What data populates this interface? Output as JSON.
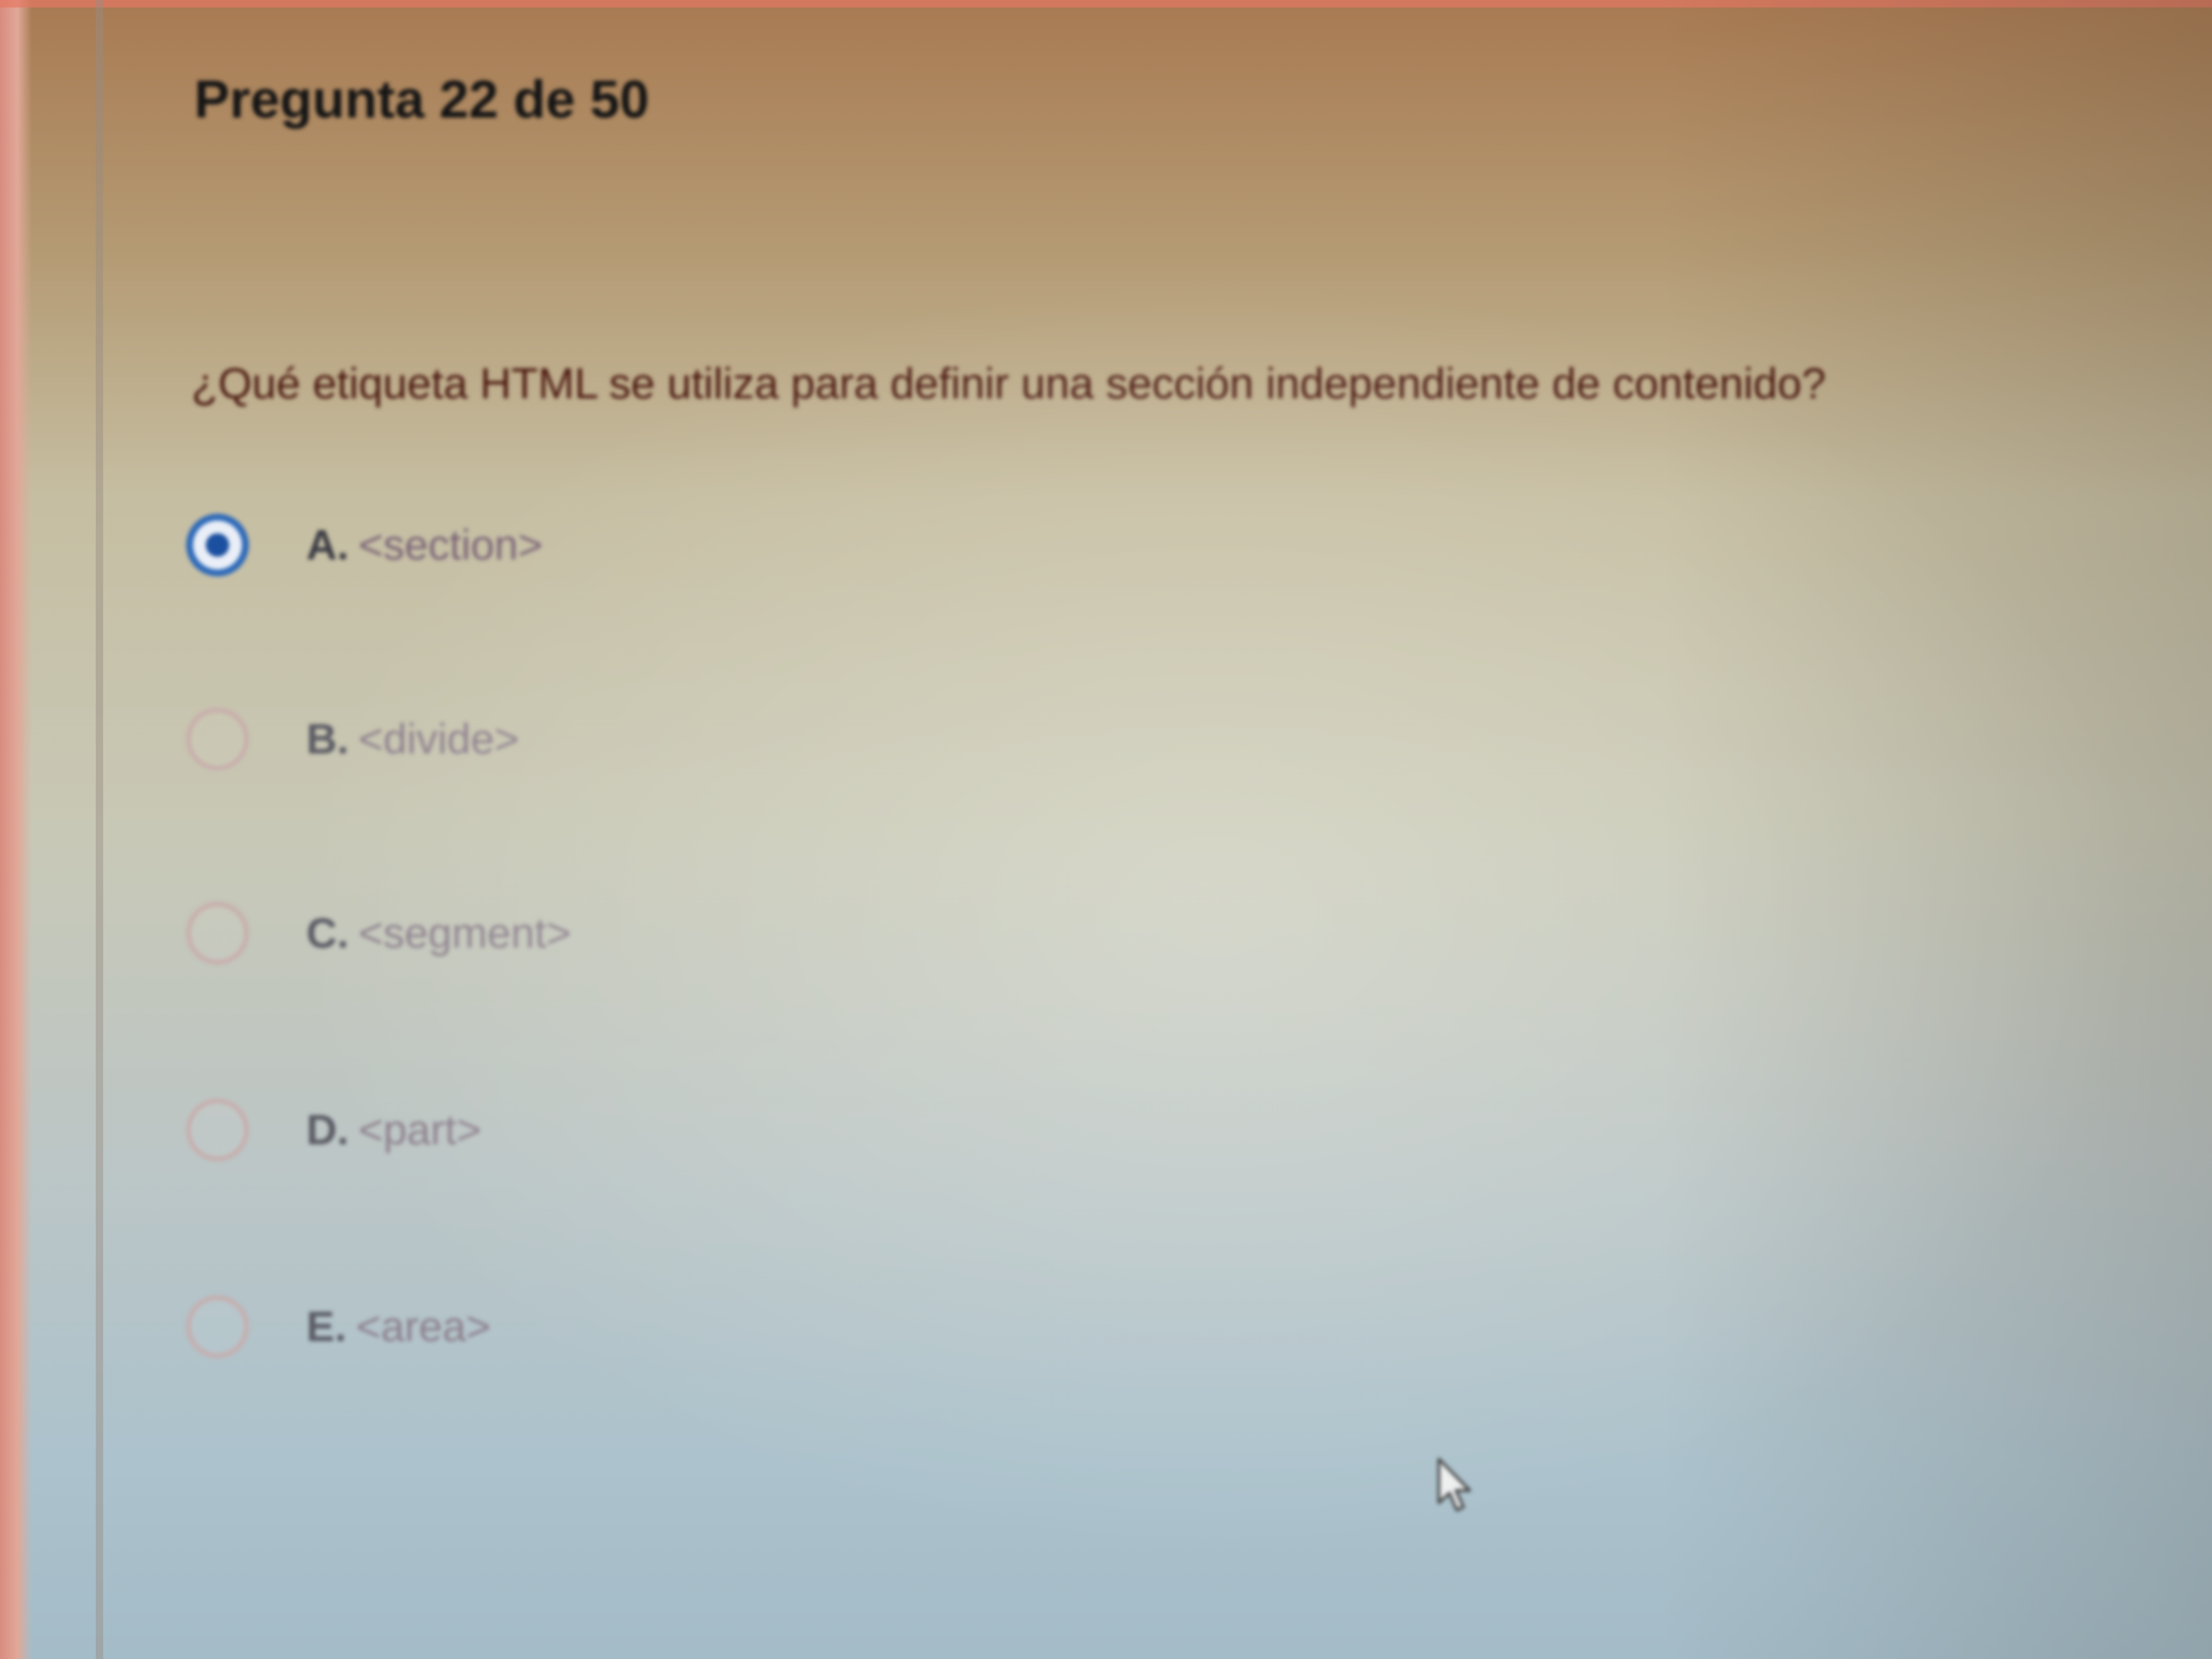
{
  "header": {
    "title": "Pregunta 22 de 50"
  },
  "question": {
    "text": "¿Qué etiqueta HTML se utiliza para definir una sección independiente de contenido?"
  },
  "options": [
    {
      "letter": "A.",
      "text": "<section>",
      "selected": true
    },
    {
      "letter": "B.",
      "text": "<divide>",
      "selected": false
    },
    {
      "letter": "C.",
      "text": "<segment>",
      "selected": false
    },
    {
      "letter": "D.",
      "text": "<part>",
      "selected": false
    },
    {
      "letter": "E.",
      "text": "<area>",
      "selected": false
    }
  ],
  "selected_option": "A.",
  "colors": {
    "radio_selected": "#2f6ab8",
    "radio_unselected": "#c8aaaa",
    "question_text": "#4a1810",
    "title_text": "#151515"
  },
  "icons": {
    "pointer": "mouse-pointer-icon"
  }
}
